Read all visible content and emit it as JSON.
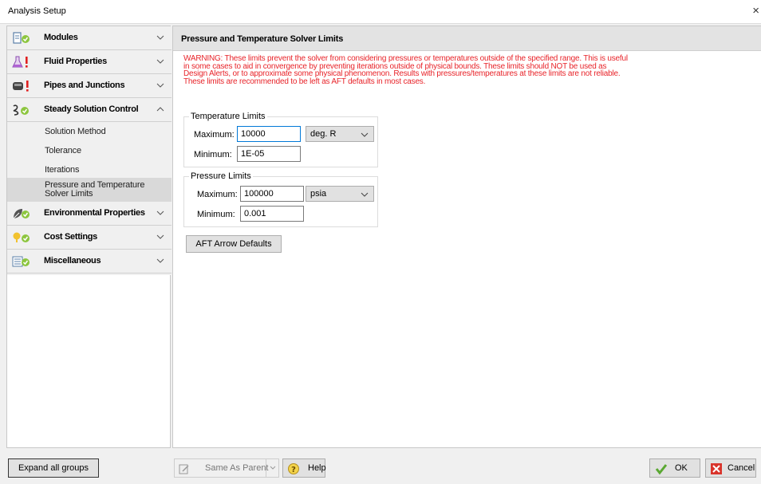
{
  "window": {
    "title": "Analysis Setup",
    "close_glyph": "×"
  },
  "sidebar": {
    "groups": [
      {
        "label": "Modules",
        "icon": "modules-icon"
      },
      {
        "label": "Fluid Properties",
        "icon": "flask-warning-icon"
      },
      {
        "label": "Pipes and Junctions",
        "icon": "pipe-warning-icon"
      },
      {
        "label": "Steady Solution Control",
        "icon": "solver-check-icon"
      },
      {
        "label": "Environmental Properties",
        "icon": "leaf-check-icon"
      },
      {
        "label": "Cost Settings",
        "icon": "cost-check-icon"
      },
      {
        "label": "Miscellaneous",
        "icon": "misc-check-icon"
      }
    ],
    "subitems": [
      "Solution Method",
      "Tolerance",
      "Iterations",
      "Pressure and Temperature Solver Limits"
    ],
    "active_subitem": "Pressure and Temperature Solver Limits"
  },
  "panel": {
    "title": "Pressure and Temperature Solver Limits",
    "warning": "WARNING: These limits prevent the solver from considering pressures or temperatures outside of the specified range. This is useful in some cases to aid in convergence by preventing iterations outside of physical bounds. These limits should NOT be used as Design Alerts, or to approximate some physical phenomenon. Results with pressures/temperatures at these limits are not reliable. These limits are recommended to be left as AFT defaults in most cases.",
    "warning_color": "#e8242a",
    "temperature": {
      "legend": "Temperature Limits",
      "max_label": "Maximum:",
      "max_value": "10000",
      "max_unit": "deg. R",
      "min_label": "Minimum:",
      "min_value": "1E-05"
    },
    "pressure": {
      "legend": "Pressure Limits",
      "max_label": "Maximum:",
      "max_value": "100000",
      "max_unit": "psia",
      "min_label": "Minimum:",
      "min_value": "0.001"
    },
    "defaults_button": "AFT Arrow Defaults"
  },
  "footer": {
    "expand_all": "Expand all groups",
    "same_as_parent": "Same As Parent",
    "help": "Help",
    "ok": "OK",
    "cancel": "Cancel"
  }
}
